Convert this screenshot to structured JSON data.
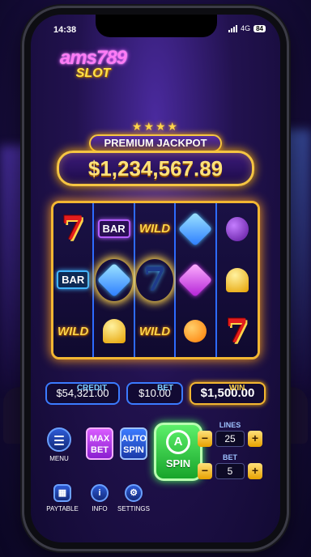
{
  "status": {
    "time": "14:38",
    "network": "4G",
    "battery": "84"
  },
  "logo": {
    "top": "ams789",
    "bottom": "SLOT"
  },
  "jackpot": {
    "label": "PREMIUM JACKPOT",
    "value": "$1,234,567.89"
  },
  "reels": [
    [
      "7",
      "BAR",
      "WILD"
    ],
    [
      "BAR",
      "diamond-gem",
      "bell"
    ],
    [
      "WILD",
      "7",
      "WILD"
    ],
    [
      "diamond-gem",
      "purple-gem",
      "orange"
    ],
    [
      "plum",
      "bell",
      "7"
    ]
  ],
  "reel_text": {
    "seven": "7",
    "bar": "BAR",
    "wild": "WILD"
  },
  "stats": {
    "credit_label": "CREDIT",
    "credit_value": "$54,321.00",
    "bet_label": "BET",
    "bet_value": "$10.00",
    "win_label": "WIN",
    "win_value": "$1,500.00"
  },
  "controls": {
    "menu_label": "MENU",
    "maxbet_line1": "MAX",
    "maxbet_line2": "BET",
    "autospin_line1": "AUTO",
    "autospin_line2": "SPIN",
    "spin_label": "SPIN",
    "spin_icon_letter": "A",
    "lines_label": "LINES",
    "lines_value": "25",
    "bet_label": "BET",
    "bet_value": "5",
    "minus": "−",
    "plus": "+"
  },
  "bottom_nav": {
    "paytable": "PAYTABLE",
    "info": "INFO",
    "settings": "SETTINGS",
    "info_glyph": "i",
    "settings_glyph": "⚙"
  },
  "colors": {
    "jackpot_gold": "#f5c542",
    "spin_green": "#17a42a",
    "reel_frame": "#f2b632",
    "maxbet_purple": "#8a1fd0"
  }
}
